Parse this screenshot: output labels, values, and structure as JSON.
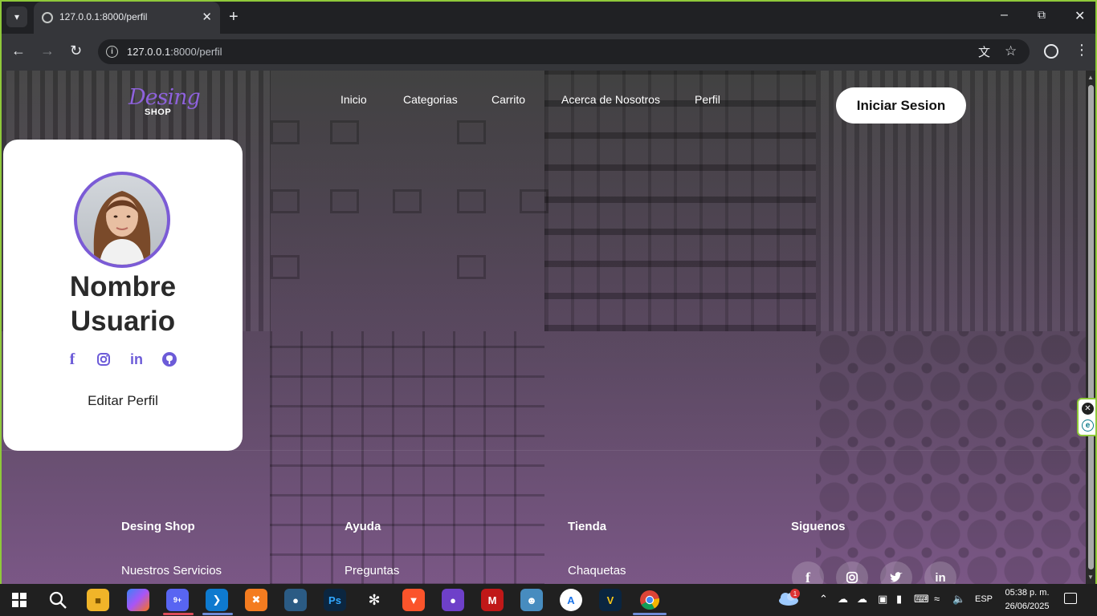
{
  "browser": {
    "tab_title": "127.0.0.1:8000/perfil",
    "url_host": "127.0.0.1",
    "url_path": ":8000/perfil"
  },
  "site": {
    "logo_main": "Desing",
    "logo_sub": "SHOP",
    "nav": [
      "Inicio",
      "Categorias",
      "Carrito",
      "Acerca de Nosotros",
      "Perfil"
    ],
    "login_button": "Iniciar Sesion"
  },
  "profile": {
    "name_line1": "Nombre",
    "name_line2": "Usuario",
    "social_icons": [
      "facebook-icon",
      "instagram-icon",
      "linkedin-icon",
      "github-icon"
    ],
    "edit_link": "Editar Perfil"
  },
  "footer": {
    "columns": [
      {
        "heading": "Desing Shop",
        "first_link": "Nuestros Servicios"
      },
      {
        "heading": "Ayuda",
        "first_link": "Preguntas"
      },
      {
        "heading": "Tienda",
        "first_link": "Chaquetas"
      },
      {
        "heading": "Siguenos"
      }
    ],
    "follow_icons": [
      "facebook-icon",
      "instagram-icon",
      "twitter-icon",
      "linkedin-icon"
    ]
  },
  "taskbar": {
    "lang": "ESP",
    "time": "05:38 p. m.",
    "date": "26/06/2025",
    "weather_badge": "1",
    "discord_badge": "9+"
  },
  "colors": {
    "accent": "#7b5bd6",
    "logo": "#8e62dc",
    "frame_border": "#8fc93a"
  }
}
